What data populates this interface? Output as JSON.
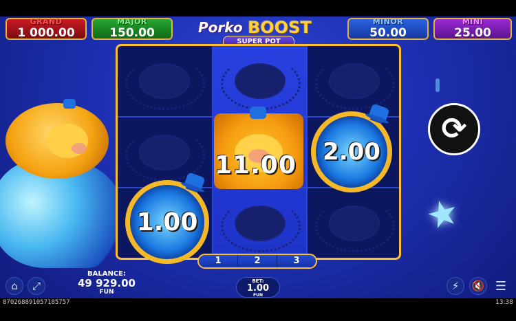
{
  "jackpots": [
    {
      "label": "GRAND",
      "value": "1 000.00",
      "label_color": "#ff4a4a",
      "bg": "#a6121a"
    },
    {
      "label": "MAJOR",
      "value": "150.00",
      "label_color": "#55e05a",
      "bg": "#1c8a2a"
    },
    {
      "label": "MINOR",
      "value": "50.00",
      "label_color": "#6fb6ff",
      "bg": "#1e4fc8"
    },
    {
      "label": "MINI",
      "value": "25.00",
      "label_color": "#e070ff",
      "bg": "#7a1fb0"
    }
  ],
  "logo": {
    "porko": "Porko",
    "boost": "BOOST",
    "superpot": "SUPER POT"
  },
  "symbols": {
    "coin_left": "1.00",
    "pig_center": "11.00",
    "coin_right": "2.00"
  },
  "reels": [
    "1",
    "2",
    "3"
  ],
  "balance": {
    "label": "BALANCE:",
    "value": "49 929.00",
    "currency": "FUN"
  },
  "bet": {
    "label": "BET:",
    "value": "1.00",
    "currency": "FUN"
  },
  "footer": {
    "round_id": "870268891057185757",
    "time": "13:38"
  },
  "icons": {
    "home": "home-icon",
    "fullscreen": "fullscreen-icon",
    "spin": "spin-icon",
    "turbo": "turbo-off-icon",
    "sound": "sound-off-icon",
    "menu": "menu-icon"
  }
}
